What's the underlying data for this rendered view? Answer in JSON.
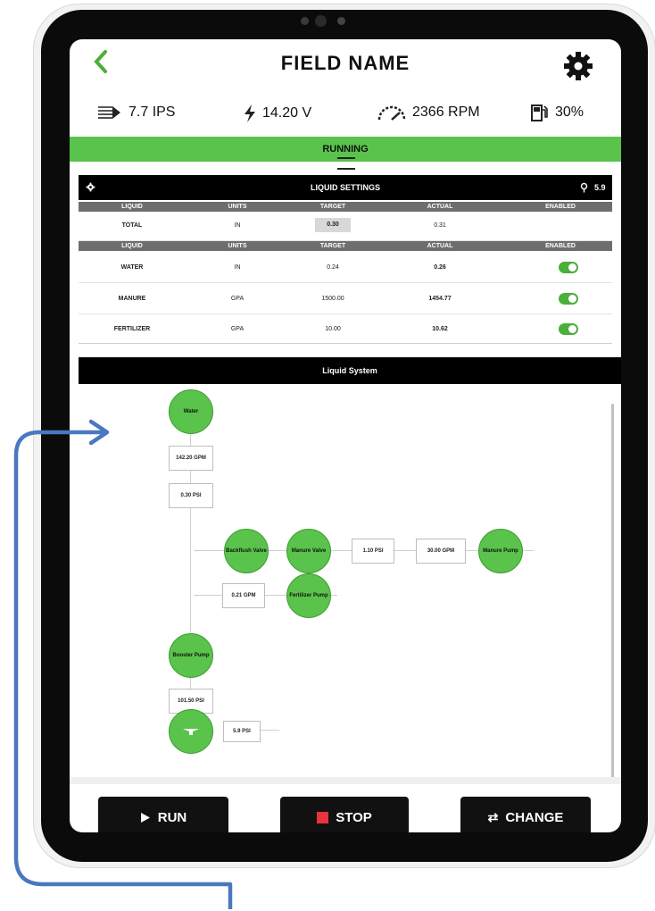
{
  "header": {
    "title": "FIELD NAME",
    "back_icon": "chevron-left-icon",
    "settings_icon": "gear-icon"
  },
  "stats": {
    "speed": "7.7 IPS",
    "voltage": "14.20 V",
    "rpm": "2366 RPM",
    "fuel": "30%"
  },
  "status": {
    "label": "RUNNING",
    "color": "#5ac34b"
  },
  "liquid_settings": {
    "title": "LIQUID SETTINGS",
    "pin_value": "5.9",
    "total_header": {
      "liquid": "LIQUID",
      "units": "UNITS",
      "target": "TARGET",
      "actual": "ACTUAL",
      "enabled": "ENABLED"
    },
    "total_row": {
      "liquid": "TOTAL",
      "units": "IN",
      "target": "0.30",
      "actual": "0.31"
    },
    "header": {
      "liquid": "LIQUID",
      "units": "UNITS",
      "target": "TARGET",
      "actual": "ACTUAL",
      "enabled": "ENABLED"
    },
    "rows": [
      {
        "liquid": "WATER",
        "units": "IN",
        "target": "0.24",
        "actual": "0.26",
        "enabled": true
      },
      {
        "liquid": "MANURE",
        "units": "GPA",
        "target": "1500.00",
        "actual": "1454.77",
        "enabled": true
      },
      {
        "liquid": "FERTILIZER",
        "units": "GPA",
        "target": "10.00",
        "actual": "10.62",
        "enabled": true
      }
    ]
  },
  "liquid_system": {
    "title": "Liquid System",
    "nodes": {
      "water": "Water",
      "backflush": "Backflush Valve",
      "manure_valve": "Manure Valve",
      "manure_pump": "Manure Pump",
      "fertilizer_pump": "Fertilizer Pump",
      "booster_pump": "Booster Pump"
    },
    "readings": {
      "flow_main": "142.20 GPM",
      "psi_main": "0.30 PSI",
      "psi_manure": "1.10 PSI",
      "gpm_manure": "30.00 GPM",
      "gpm_fert": "0.21 GPM",
      "psi_booster": "101.50 PSI",
      "psi_out": "5.9 PSI"
    }
  },
  "buttons": {
    "run": "RUN",
    "stop": "STOP",
    "change": "CHANGE"
  },
  "colors": {
    "accent_green": "#5ac34b",
    "stop_red": "#e8333a",
    "annotation_blue": "#4a78bf"
  }
}
